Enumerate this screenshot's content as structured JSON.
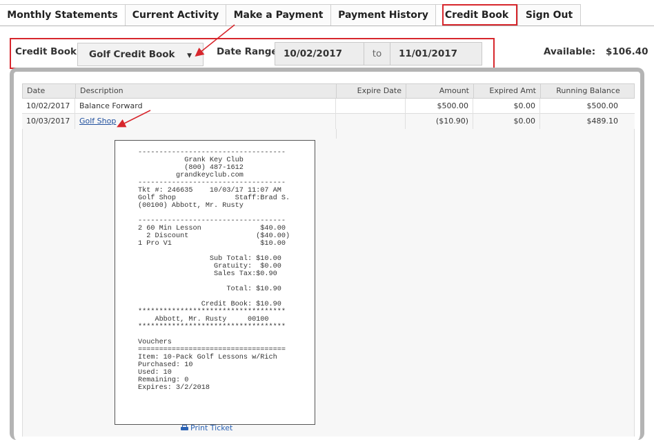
{
  "tabs": [
    {
      "label": "Monthly Statements"
    },
    {
      "label": "Current Activity"
    },
    {
      "label": "Make a Payment"
    },
    {
      "label": "Payment History"
    },
    {
      "label": "Credit Book"
    },
    {
      "label": "Sign Out"
    }
  ],
  "filter": {
    "credit_book_label": "Credit Book:",
    "credit_book_value": "Golf Credit Book",
    "date_range_label": "Date Range:",
    "date_from": "10/02/2017",
    "to_label": "to",
    "date_to": "11/01/2017",
    "available_label": "Available:",
    "available_value": "$106.40"
  },
  "table": {
    "columns": [
      "Date",
      "Description",
      "Expire Date",
      "Amount",
      "Expired Amt",
      "Running Balance"
    ],
    "rows": [
      {
        "date": "10/02/2017",
        "description": "Balance Forward",
        "expire": "",
        "amount": "$500.00",
        "expired": "$0.00",
        "balance": "$500.00"
      },
      {
        "date": "10/03/2017",
        "description": "Golf Shop",
        "expire": "",
        "amount": "($10.90)",
        "expired": "$0.00",
        "balance": "$489.10"
      }
    ]
  },
  "receipt": {
    "lines": [
      "-----------------------------------",
      "           Grank Key Club",
      "           (800) 487-1612",
      "         grandkeyclub.com",
      "-----------------------------------",
      "Tkt #: 246635    10/03/17 11:07 AM",
      "Golf Shop              Staff:Brad S.",
      "(00100) Abbott, Mr. Rusty",
      "",
      "-----------------------------------",
      "2 60 Min Lesson              $40.00",
      "  2 Discount                ($40.00)",
      "1 Pro V1                     $10.00",
      "",
      "                 Sub Total: $10.00",
      "                  Gratuity:  $0.00",
      "                  Sales Tax:$0.90",
      "",
      "                     Total: $10.90",
      "",
      "               Credit Book: $10.90",
      "***********************************",
      "    Abbott, Mr. Rusty     00100",
      "***********************************",
      "",
      "Vouchers",
      "===================================",
      "Item: 10-Pack Golf Lessons w/Rich",
      "Purchased: 10",
      "Used: 10",
      "Remaining: 0",
      "Expires: 3/2/2018"
    ],
    "print_label": "Print Ticket"
  },
  "colors": {
    "highlight": "#d7262c",
    "link": "#1f4f9d",
    "panel_border": "#b4b4b4"
  }
}
